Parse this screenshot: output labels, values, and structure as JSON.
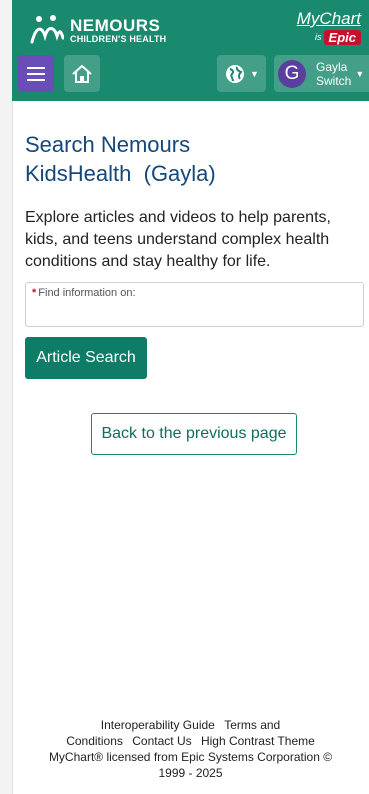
{
  "header": {
    "brand_name": "NEMOURS",
    "brand_sub": "CHILDREN'S HEALTH",
    "mychart_name": "MyChart",
    "mychart_is": "is",
    "mychart_epic": "Epic",
    "user_initial": "G",
    "user_name": "Gayla",
    "user_switch": "Switch",
    "accent": "#1a8a6e",
    "menu_color": "#6a4eb8",
    "icons": [
      "hamburger-menu-icon",
      "home-icon",
      "globe-icon",
      "chevron-down-icon"
    ]
  },
  "main": {
    "title_line1": "Search Nemours",
    "title_line2": "KidsHealth  (Gayla)",
    "description": "Explore articles and videos to help parents, kids, and teens understand complex health conditions and stay healthy for life.",
    "field_required_mark": "*",
    "field_label": "Find information on:",
    "field_value": "",
    "search_button": "Article Search",
    "back_button": "Back to the previous page"
  },
  "footer": {
    "link_interop": "Interoperability Guide",
    "link_terms": "Terms and Conditions",
    "link_contact": "Contact Us",
    "link_contrast": "High Contrast Theme",
    "license": "MyChart® licensed from Epic Systems Corporation ©",
    "years": "1999 - 2025"
  }
}
